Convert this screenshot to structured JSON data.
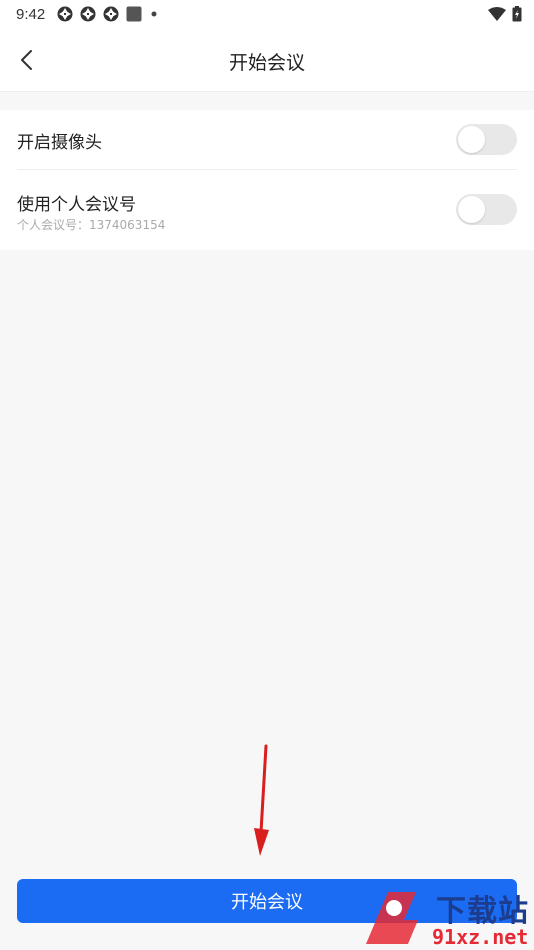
{
  "status_bar": {
    "time": "9:42",
    "left_icons": [
      "aperture-icon",
      "aperture-icon",
      "aperture-icon",
      "square-icon",
      "dot-icon"
    ],
    "right_icons": [
      "wifi-icon",
      "battery-icon"
    ]
  },
  "nav": {
    "back_icon": "chevron-left-icon",
    "title": "开始会议"
  },
  "settings": {
    "camera": {
      "label": "开启摄像头",
      "enabled": false
    },
    "personal_meeting": {
      "label": "使用个人会议号",
      "sub": "个人会议号：1374063154",
      "enabled": false
    }
  },
  "start_button": {
    "label": "开始会议"
  },
  "colors": {
    "primary": "#1b6cf2",
    "background": "#f7f7f7",
    "toggle_off": "#e8e8e8",
    "annotation_arrow": "#d81e1e"
  },
  "watermark": {
    "top": "下载站",
    "bottom": "91xz.net"
  }
}
